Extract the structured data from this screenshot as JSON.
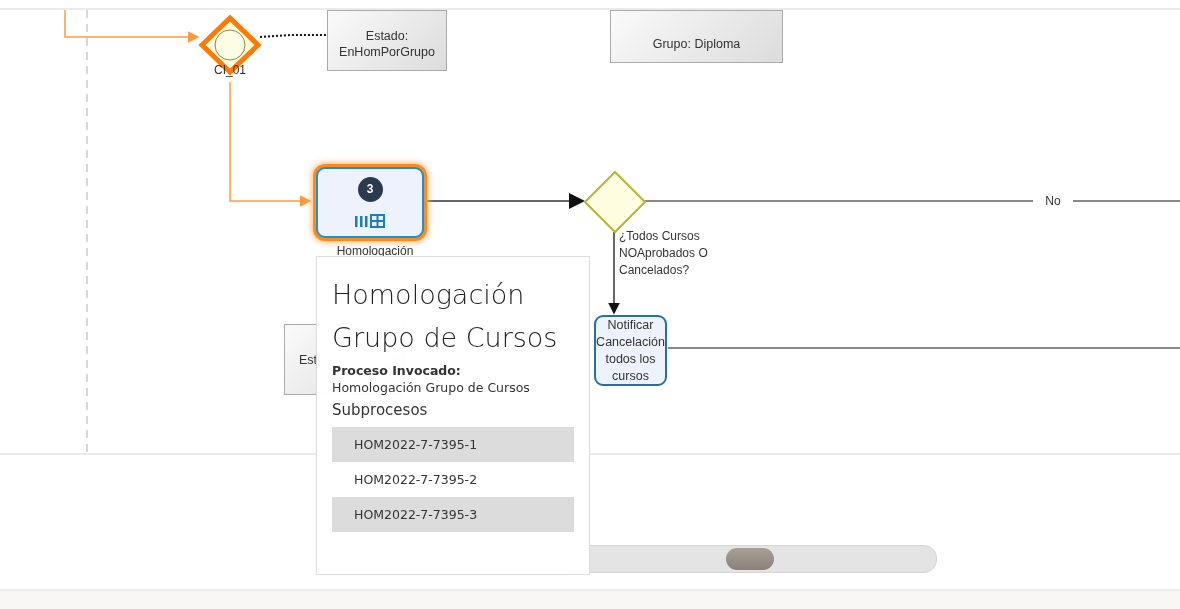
{
  "diagram": {
    "nodes": [
      {
        "kind": "gateway",
        "label": "CI_01",
        "highlighted": true
      },
      {
        "kind": "note",
        "label": "Estado: EnHomPorGrupo"
      },
      {
        "kind": "note",
        "label": "Grupo: Diploma"
      },
      {
        "kind": "subprocess",
        "label": "Homologación",
        "badge": "3",
        "highlighted": true
      },
      {
        "kind": "decision",
        "label": "¿Todos Cursos NOAprobados O Cancelados?"
      },
      {
        "kind": "note",
        "label": "Est"
      },
      {
        "kind": "task",
        "label": "Notificar Cancelación todos los cursos"
      }
    ],
    "flow_labels": [
      "No"
    ]
  },
  "tooltip": {
    "title": "Homologación Grupo de Cursos",
    "field_label": "Proceso Invocado:",
    "field_value": "Homologación Grupo de Cursos",
    "section": "Subprocesos",
    "items": [
      "HOM2022-7-7395-1",
      "HOM2022-7-7395-2",
      "HOM2022-7-7395-3"
    ]
  }
}
